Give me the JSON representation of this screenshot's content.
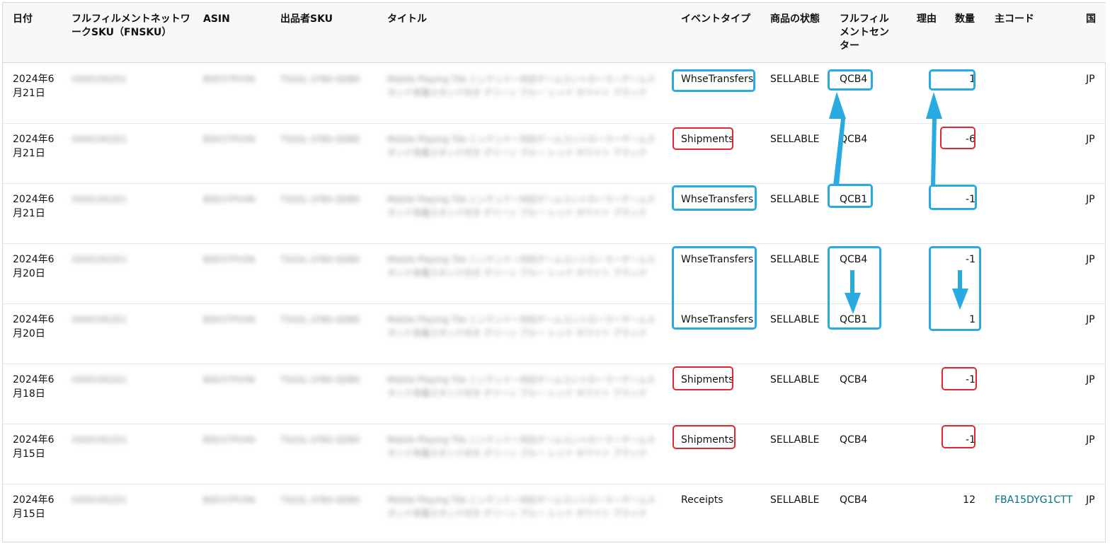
{
  "headers": {
    "date": "日付",
    "fnsku": "フルフィルメントネットワークSKU（FNSKU）",
    "asin": "ASIN",
    "seller_sku": "出品者SKU",
    "title": "タイトル",
    "event_type": "イベントタイプ",
    "disposition": "商品の状態",
    "fulfillment_center": "フルフィルメントセンター",
    "reason": "理由",
    "quantity": "数量",
    "reference_id": "主コード",
    "country": "国"
  },
  "blurred": {
    "fnsku": "X00019S2D1",
    "asin": "B0D37PVXN",
    "seller_sku": "TSGSL-1FB0-QDB0",
    "title": "Mobile Playing Tile ニンテンドー対応ゲームコントローラーゲームスタンド充電スタンド付き グリーン ブルー レッド ホワイト ブラック"
  },
  "rows": [
    {
      "date": "2024年6月21日",
      "event_type": "WhseTransfers",
      "disposition": "SELLABLE",
      "fc": "QCB4",
      "reason": "",
      "quantity": "1",
      "reference": "",
      "country": "JP"
    },
    {
      "date": "2024年6月21日",
      "event_type": "Shipments",
      "disposition": "SELLABLE",
      "fc": "QCB4",
      "reason": "",
      "quantity": "-6",
      "reference": "",
      "country": "JP"
    },
    {
      "date": "2024年6月21日",
      "event_type": "WhseTransfers",
      "disposition": "SELLABLE",
      "fc": "QCB1",
      "reason": "",
      "quantity": "-1",
      "reference": "",
      "country": "JP"
    },
    {
      "date": "2024年6月20日",
      "event_type": "WhseTransfers",
      "disposition": "SELLABLE",
      "fc": "QCB4",
      "reason": "",
      "quantity": "-1",
      "reference": "",
      "country": "JP"
    },
    {
      "date": "2024年6月20日",
      "event_type": "WhseTransfers",
      "disposition": "SELLABLE",
      "fc": "QCB1",
      "reason": "",
      "quantity": "1",
      "reference": "",
      "country": "JP"
    },
    {
      "date": "2024年6月18日",
      "event_type": "Shipments",
      "disposition": "SELLABLE",
      "fc": "QCB4",
      "reason": "",
      "quantity": "-1",
      "reference": "",
      "country": "JP"
    },
    {
      "date": "2024年6月15日",
      "event_type": "Shipments",
      "disposition": "SELLABLE",
      "fc": "QCB4",
      "reason": "",
      "quantity": "-1",
      "reference": "",
      "country": "JP"
    },
    {
      "date": "2024年6月15日",
      "event_type": "Receipts",
      "disposition": "SELLABLE",
      "fc": "QCB4",
      "reason": "",
      "quantity": "12",
      "reference": "FBA15DYG1CTT",
      "country": "JP"
    }
  ],
  "annotation_colors": {
    "transfer_highlight": "#29abe2",
    "shipment_highlight": "#e3262d"
  }
}
